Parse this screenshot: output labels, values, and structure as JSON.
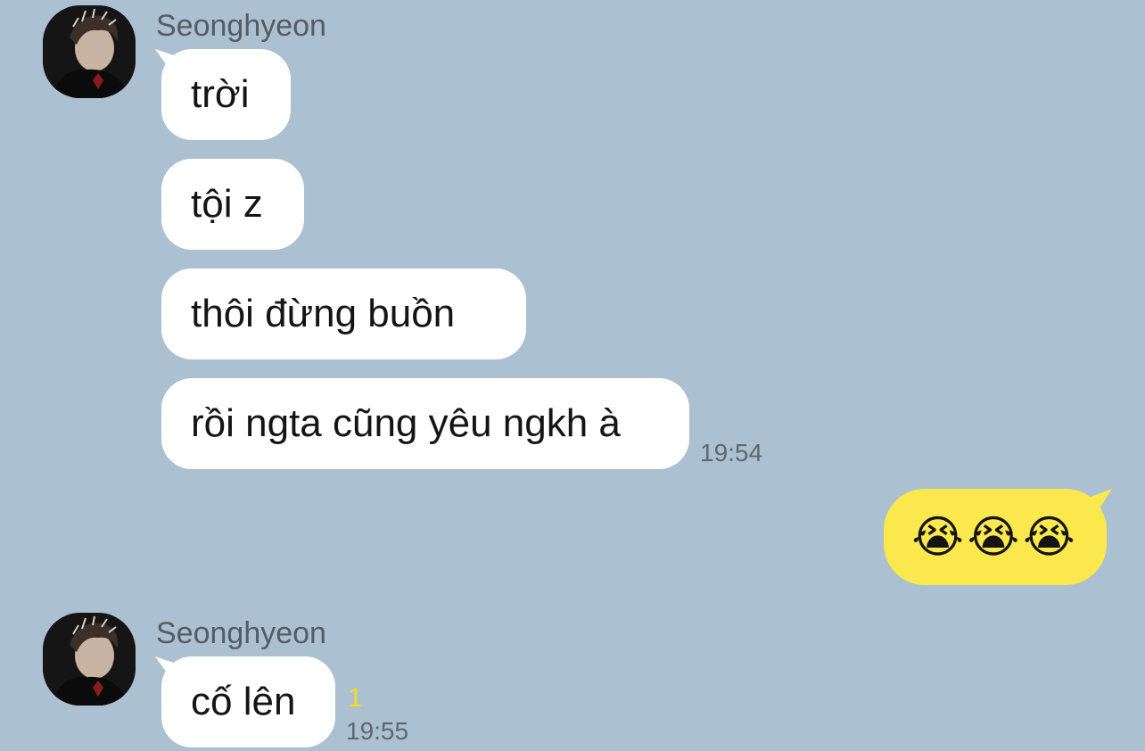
{
  "theme": {
    "background": "#abc0d1",
    "incoming_bubble": "#ffffff",
    "outgoing_bubble": "#fbe84d",
    "unread_color": "#f5dd1f"
  },
  "groups": [
    {
      "sender": "Seonghyeon",
      "avatar_icon": "profile-photo",
      "messages": [
        "trời",
        "tội z",
        "thôi đừng buồn",
        "rồi ngta cũng yêu ngkh à"
      ],
      "time": "19:54"
    },
    {
      "sender": "Seonghyeon",
      "avatar_icon": "profile-photo",
      "messages": [
        "cố lên"
      ],
      "unread": "1",
      "time": "19:55"
    }
  ],
  "outgoing": [
    {
      "text": "😭😭😭"
    }
  ]
}
